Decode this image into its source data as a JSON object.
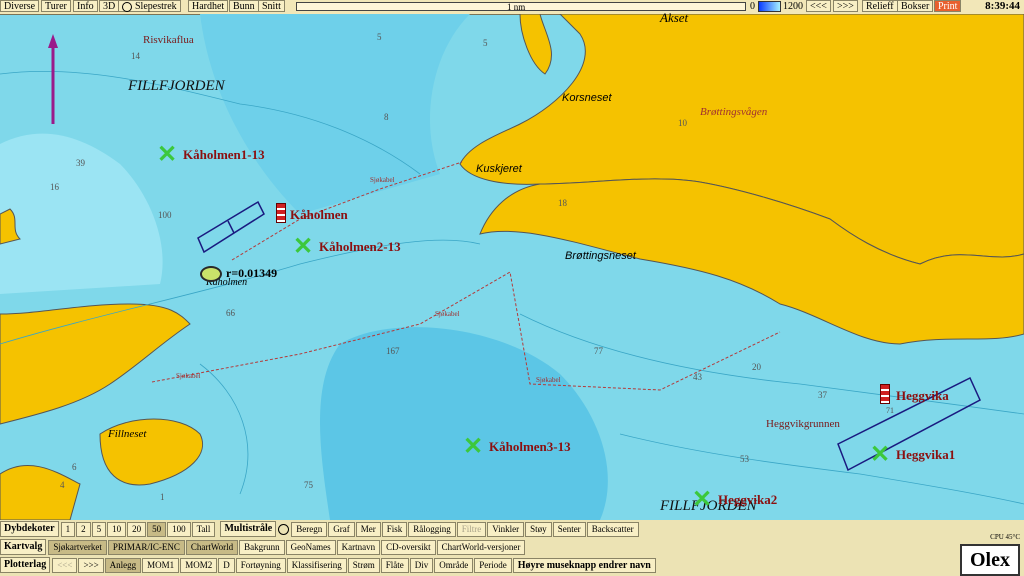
{
  "toolbar": {
    "buttons": [
      "Diverse",
      "Turer",
      "Info",
      "3D",
      "Slepestrek",
      "Hardhet",
      "Bunn",
      "Snitt"
    ],
    "scale_label": "1 nm",
    "depth_min": "0",
    "depth_max": "1200",
    "right_buttons": [
      "<<<",
      ">>>",
      "Relieff",
      "Bokser",
      "Print"
    ],
    "time": "8:39:44"
  },
  "map": {
    "place_names": [
      "Risvikaflua",
      "FILLFJORDEN",
      "Korsneset",
      "Brøttingsvågen",
      "Kuskjeret",
      "Brøttingsneset",
      "Heggvikgrunnen",
      "Fillneset",
      "FILLFJORDEN",
      "Akset",
      "Kåholmen"
    ],
    "waypoints": [
      "Kåholmen1-13",
      "Kåholmen2-13",
      "Kåholmen3-13",
      "Heggvika1",
      "Heggvika2"
    ],
    "flags": [
      "Kåholmen",
      "Heggvika"
    ],
    "radius_label": "r=0.01349",
    "cable_label": "Sjøkabel",
    "depths": [
      "14",
      "5",
      "5",
      "8",
      "39",
      "16",
      "100",
      "66",
      "167",
      "77",
      "20",
      "43",
      "37",
      "71",
      "53",
      "75",
      "18",
      "10",
      "4",
      "1",
      "6"
    ]
  },
  "bottombar": {
    "row1_label": "Dybdekoter",
    "row1_values": [
      "1",
      "2",
      "5",
      "10",
      "20",
      "50",
      "100",
      "Tall"
    ],
    "row1_selected": "50",
    "multi_label": "Multistråle",
    "multi_items": [
      "Beregn",
      "Graf",
      "Mer",
      "Fisk",
      "Rålogging",
      "Filtre",
      "Vinkler",
      "Støy",
      "Senter",
      "Backscatter"
    ],
    "row2_label": "Kartvalg",
    "row2_items": [
      "Sjøkartverket",
      "PRIMAR/IC-ENC",
      "ChartWorld",
      "Bakgrunn",
      "GeoNames",
      "Kartnavn",
      "CD-oversikt",
      "ChartWorld-versjoner"
    ],
    "row3_label": "Plotterlag",
    "row3_items": [
      "<<<",
      ">>>",
      "Anlegg",
      "MOM1",
      "MOM2",
      "D",
      "Fortøyning",
      "Klassifisering",
      "Strøm",
      "Flåte",
      "Div",
      "Område",
      "Periode"
    ],
    "row3_hint": "Høyre museknapp endrer navn",
    "cpu": "CPU 45°C",
    "logo": "Olex"
  },
  "colors": {
    "land": "#f5c200",
    "shallow": "#a6ecf5",
    "deep": "#5cc6e6",
    "waypoint": "#3cc83c",
    "label": "#8b1010"
  }
}
